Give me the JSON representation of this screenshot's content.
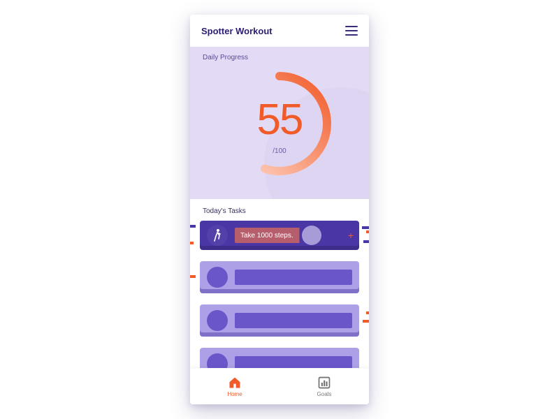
{
  "header": {
    "title": "Spotter Workout"
  },
  "progress": {
    "label": "Daily Progress",
    "value": "55",
    "total": "/100",
    "percent": 55
  },
  "tasks": {
    "title": "Today's Tasks",
    "items": [
      {
        "label": "Take 1000 steps.",
        "icon": "walk-icon",
        "active": true
      },
      {
        "label": "",
        "icon": "",
        "active": false
      },
      {
        "label": "",
        "icon": "",
        "active": false
      },
      {
        "label": "",
        "icon": "",
        "active": false
      }
    ]
  },
  "nav": {
    "home": "Home",
    "goals": "Goals"
  },
  "colors": {
    "accent": "#f15a29",
    "primary": "#4a36a5",
    "chip": "#aea0e6",
    "panel": "#e3dbf6"
  }
}
